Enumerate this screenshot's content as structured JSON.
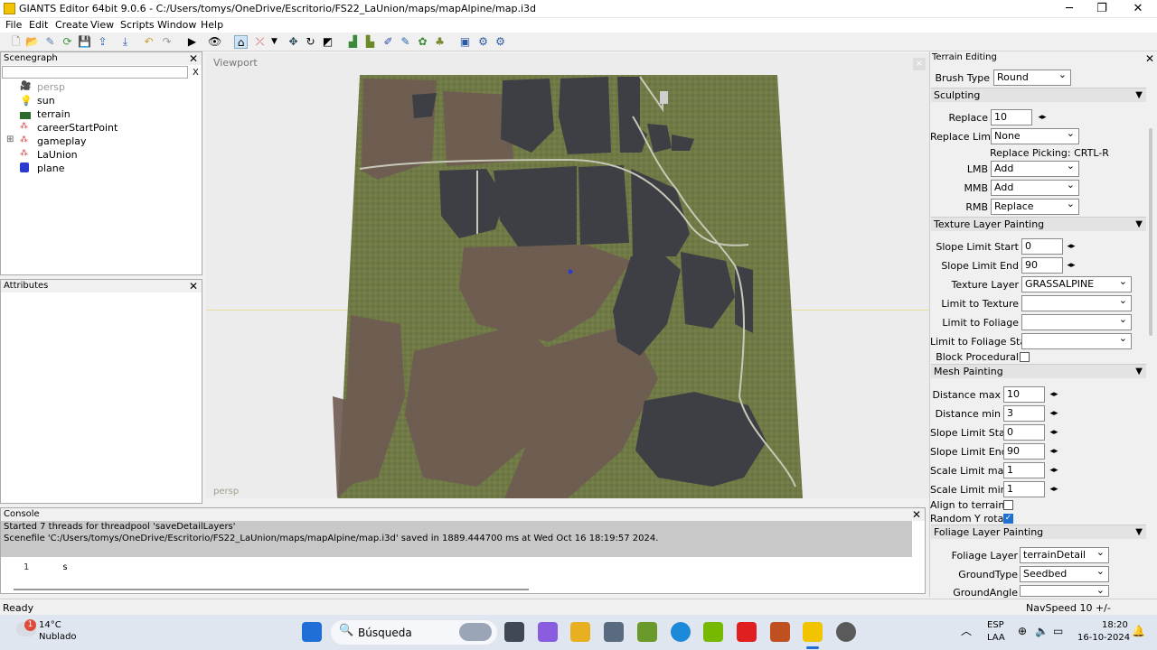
{
  "window": {
    "title": "GIANTS Editor 64bit 9.0.6 - C:/Users/tomys/OneDrive/Escritorio/FS22_LaUnion/maps/mapAlpine/map.i3d",
    "minimize": "─",
    "maximize": "❐",
    "close": "✕"
  },
  "menu": [
    "File",
    "Edit",
    "Create",
    "View",
    "Scripts",
    "Window",
    "Help"
  ],
  "scenegraph": {
    "title": "Scenegraph",
    "close": "✕",
    "filter_clear": "X",
    "items": [
      "persp",
      "sun",
      "terrain",
      "careerStartPoint",
      "gameplay",
      "LaUnion",
      "plane"
    ],
    "expand": "⊞"
  },
  "attributes": {
    "title": "Attributes",
    "close": "✕"
  },
  "viewport": {
    "title": "Viewport",
    "camera": "persp",
    "close": "×"
  },
  "terrain_editing": {
    "title": "Terrain Editing",
    "close": "✕",
    "brush_type_label": "Brush Type",
    "brush_type": "Round",
    "sculpting": {
      "header": "Sculpting",
      "replace_label": "Replace",
      "replace": "10",
      "replace_limit_label": "Replace Limit",
      "replace_limit": "None",
      "picking_hint": "Replace Picking: CRTL-R",
      "lmb_label": "LMB",
      "lmb": "Add",
      "mmb_label": "MMB",
      "mmb": "Add",
      "rmb_label": "RMB",
      "rmb": "Replace"
    },
    "texture": {
      "header": "Texture Layer Painting",
      "slope_start_label": "Slope Limit Start",
      "slope_start": "0",
      "slope_end_label": "Slope Limit End",
      "slope_end": "90",
      "layer_label": "Texture Layer",
      "layer": "GRASSALPINE",
      "limit_texture_label": "Limit to Texture",
      "limit_texture": "",
      "limit_foliage_label": "Limit to Foliage",
      "limit_foliage": "",
      "limit_foliage_state_label": "Limit to Foliage State",
      "limit_foliage_state": "",
      "block_procedural_label": "Block Procedural",
      "block_procedural": false
    },
    "mesh": {
      "header": "Mesh Painting",
      "dist_max_label": "Distance max",
      "dist_max": "10",
      "dist_min_label": "Distance min",
      "dist_min": "3",
      "slope_start_label": "Slope Limit Start",
      "slope_start": "0",
      "slope_end_label": "Slope Limit End",
      "slope_end": "90",
      "scale_max_label": "Scale Limit max",
      "scale_max": "1",
      "scale_min_label": "Scale Limit min",
      "scale_min": "1",
      "align_label": "Align to terrain",
      "align": false,
      "random_label": "Random Y rotate",
      "random": true
    },
    "foliage": {
      "header": "Foliage Layer Painting",
      "layer_label": "Foliage Layer",
      "layer": "terrainDetail",
      "groundtype_label": "GroundType",
      "groundtype": "Seedbed",
      "groundangle_label": "GroundAngle",
      "groundangle": ""
    }
  },
  "console": {
    "title": "Console",
    "close": "✕",
    "lines": [
      "Started 7 threads for threadpool 'saveDetailLayers'",
      "Scenefile 'C:/Users/tomys/OneDrive/Escritorio/FS22_LaUnion/maps/mapAlpine/map.i3d' saved in 1889.444700 ms at Wed Oct 16 18:19:57 2024."
    ],
    "line_no": "1",
    "input": "s"
  },
  "status": {
    "left": "Ready",
    "right": "NavSpeed 10 +/-"
  },
  "taskbar": {
    "temp": "14°C",
    "weather": "Nublado",
    "search": "Búsqueda",
    "lang1": "ESP",
    "lang2": "LAA",
    "time": "18:20",
    "date": "16-10-2024",
    "badge": "1"
  }
}
